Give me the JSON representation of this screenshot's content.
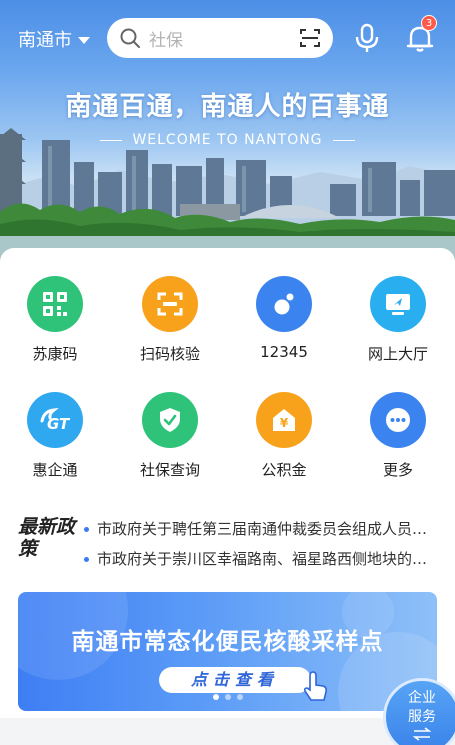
{
  "header": {
    "city": "南通市",
    "search_placeholder": "社保",
    "notification_count": "3"
  },
  "hero": {
    "slogan": "南通百通，南通人的百事通",
    "subtitle": "WELCOME TO NANTONG"
  },
  "services": [
    {
      "label": "苏康码",
      "icon": "qr-code-icon",
      "color": "#2fc37a"
    },
    {
      "label": "扫码核验",
      "icon": "scan-icon",
      "color": "#f8a21c"
    },
    {
      "label": "12345",
      "icon": "hotline-icon",
      "color": "#3b84f0"
    },
    {
      "label": "网上大厅",
      "icon": "online-hall-icon",
      "color": "#29aef0"
    },
    {
      "label": "惠企通",
      "icon": "enterprise-icon",
      "color": "#2fa8f0"
    },
    {
      "label": "社保查询",
      "icon": "shield-check-icon",
      "color": "#2fc37a"
    },
    {
      "label": "公积金",
      "icon": "housing-fund-icon",
      "color": "#f8a21c"
    },
    {
      "label": "更多",
      "icon": "more-icon",
      "color": "#3b84f0"
    }
  ],
  "news": {
    "title": "最新政策",
    "items": [
      "市政府关于聘任第三届南通仲裁委员会组成人员的通知",
      "市政府关于崇川区幸福路南、福星路西侧地块的批复"
    ]
  },
  "banner": {
    "title": "南通市常态化便民核酸采样点",
    "button": "点击查看"
  },
  "float_button": {
    "line1": "企业",
    "line2": "服务"
  }
}
